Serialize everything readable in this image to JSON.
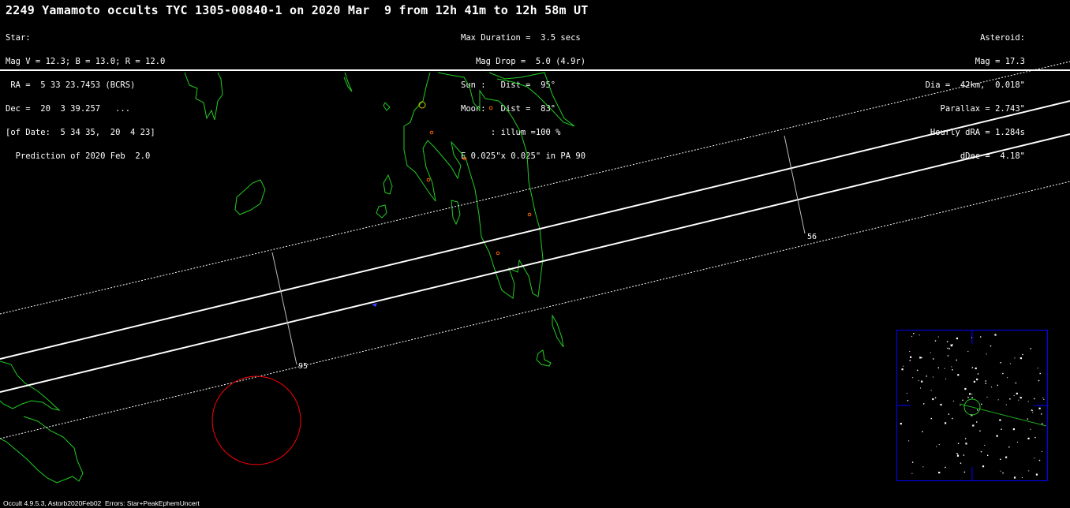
{
  "title": "2249 Yamamoto occults TYC 1305-00840-1 on 2020 Mar  9 from 12h 41m to 12h 58m UT",
  "star_block": [
    "Star:",
    "Mag V = 12.3; B = 13.0; R = 12.0",
    " RA =  5 33 23.7453 (BCRS)",
    "Dec =  20  3 39.257   ...",
    "[of Date:  5 34 35,  20  4 23]",
    "  Prediction of 2020 Feb  2.0"
  ],
  "event_block": [
    "Max Duration =  3.5 secs",
    "   Mag Drop =  5.0 (4.9r)",
    "Sun :   Dist =  95°",
    "Moon:   Dist =  83°",
    "      : illum =100 %",
    "E 0.025\"x 0.025\" in PA 90"
  ],
  "asteroid_block": [
    "Asteroid:",
    "Mag = 17.3",
    "Dia =  42km,  0.018\"",
    "Parallax = 2.743\"",
    "Hourly dRA = 1.284s",
    "dDec =  4.18\""
  ],
  "tick_labels": {
    "left": "95",
    "right": "56"
  },
  "footer": "Occult 4.9.5.3, Astorb2020Feb02  Errors: Star+PeakEphemUncert",
  "colors": {
    "background": "#000000",
    "path_lines": "#ffffff",
    "coastline": "#22cc22",
    "site_markers": "#ff6600",
    "error_circle": "#ff0000",
    "inset_frame": "#0000ff"
  }
}
